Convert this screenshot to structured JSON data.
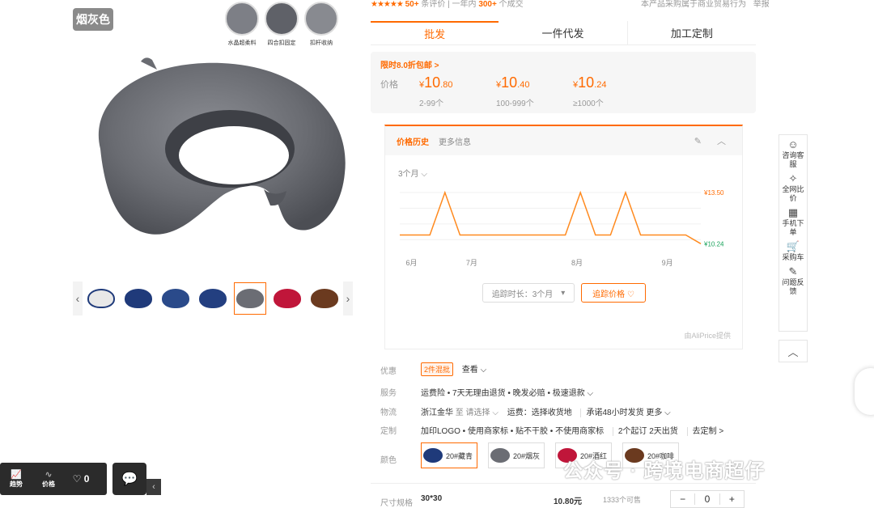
{
  "gallery": {
    "color_tag": "烟灰色",
    "features": [
      "水晶超柔料",
      "四合扣固定",
      "扣杆收纳"
    ],
    "thumbnails": [
      "white",
      "navy",
      "navy",
      "navy",
      "gray",
      "red",
      "brown"
    ]
  },
  "header": {
    "stars": "★★★★★",
    "reviews": "50+",
    "reviews_label": "条评价",
    "sold_prefix": "一年内",
    "sold": "300+",
    "sold_suffix": "个成交",
    "right_text": "本产品采购属于商业贸易行为",
    "report": "举报"
  },
  "tabs": [
    "批发",
    "一件代发",
    "加工定制"
  ],
  "pricing": {
    "promo": "限时8.0折包邮 >",
    "label": "价格",
    "currency": "¥",
    "tiers": [
      {
        "int": "10",
        "dec": ".80",
        "range": "2-99个"
      },
      {
        "int": "10",
        "dec": ".40",
        "range": "100-999个"
      },
      {
        "int": "10",
        "dec": ".24",
        "range": "≥1000个"
      }
    ]
  },
  "history": {
    "tab_active": "价格历史",
    "tab_other": "更多信息",
    "icons": "✎ ︿",
    "period": "3个月 ⌵",
    "track_duration": "追踪时长：3个月",
    "track_button": "追踪价格 ♡",
    "credit": "由AliPrice提供"
  },
  "chart_data": {
    "type": "line",
    "x_ticks": [
      "6月",
      "7月",
      "8月",
      "9月"
    ],
    "y_labels": [
      "¥13.50",
      "¥10.24"
    ],
    "series": [
      {
        "values": [
          10.8,
          10.8,
          10.8,
          13.5,
          10.8,
          10.8,
          10.8,
          10.8,
          10.8,
          10.8,
          10.8,
          10.8,
          13.5,
          10.8,
          10.8,
          13.5,
          10.8,
          10.8,
          10.8,
          10.8,
          10.24
        ]
      }
    ]
  },
  "info": {
    "discount_label": "优惠",
    "discount_chip": "2件混批",
    "discount_link": "查看 ⌵",
    "service_label": "服务",
    "service_value": "运费险 • 7天无理由退货 • 晚发必赔 • 极速退款 ⌵",
    "logistics_label": "物流",
    "logistics_from": "浙江金华",
    "logistics_to": "至 请选择 ⌵",
    "logistics_fee": "运费：选择收货地",
    "logistics_ship": "承诺48小时发货 更多 ⌵",
    "custom_label": "定制",
    "custom_value": "加印LOGO • 使用商家标 • 贴不干胶 • 不使用商家标",
    "custom_min": "2个起订 2天出货",
    "custom_link": "去定制 >",
    "color_label": "颜色",
    "size_label": "尺寸规格",
    "size_value": "30*30",
    "size_price": "10.80元",
    "size_stock": "1333个可售"
  },
  "colors": [
    {
      "name": "20#藏青",
      "hex": "#1f3a7a"
    },
    {
      "name": "20#烟灰",
      "hex": "#6b6d74"
    },
    {
      "name": "20#酒红",
      "hex": "#c0163a"
    },
    {
      "name": "20#咖啡",
      "hex": "#6b3a1f"
    }
  ],
  "stepper": {
    "minus": "−",
    "value": "0",
    "plus": "+"
  },
  "sidebar": [
    {
      "icon": "☺",
      "label": "咨询客服"
    },
    {
      "icon": "✧",
      "label": "全网比价"
    },
    {
      "icon": "▦",
      "label": "手机下单"
    },
    {
      "icon": "🛒",
      "label": "采购车"
    },
    {
      "icon": "✎",
      "label": "问题反馈"
    }
  ],
  "sidebar_top": "︿",
  "bottom_bar": {
    "trend": "趋势",
    "price": "价格",
    "likes": "♡ 0"
  },
  "watermark": "公众号 · 跨境电商超仔"
}
